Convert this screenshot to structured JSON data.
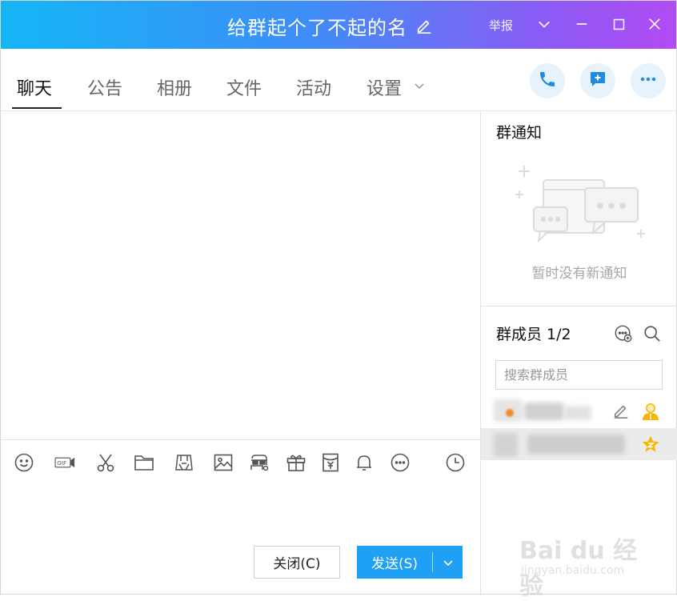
{
  "window": {
    "title": "给群起个了不起的名",
    "report_label": "举报"
  },
  "tabs": [
    {
      "label": "聊天",
      "active": true
    },
    {
      "label": "公告",
      "active": false
    },
    {
      "label": "相册",
      "active": false
    },
    {
      "label": "文件",
      "active": false
    },
    {
      "label": "活动",
      "active": false
    },
    {
      "label": "设置",
      "active": false
    }
  ],
  "header_actions": [
    "phone-icon",
    "add-message-icon",
    "more-icon"
  ],
  "toolbar_icons": [
    "emoji-icon",
    "gif-icon",
    "scissors-icon",
    "folder-icon",
    "screen-record-icon",
    "image-icon",
    "mask-icon",
    "gift-icon",
    "red-packet-icon",
    "bell-icon",
    "more-circle-icon",
    "history-clock-icon"
  ],
  "buttons": {
    "close_label": "关闭(C)",
    "send_label": "发送(S)"
  },
  "right_panel": {
    "notice_title": "群通知",
    "notice_empty": "暂时没有新通知",
    "members_title": "群成员 1/2",
    "member_search_placeholder": "搜索群成员"
  },
  "watermark": {
    "logo": "Bai du 经验",
    "url": "jingyan.baidu.com"
  },
  "colors": {
    "title_gradient_start": "#14b6f7",
    "title_gradient_end": "#b24bf3",
    "accent": "#1ea0f5",
    "round_button_bg": "#e6f3fc",
    "owner_star": "#f5b800"
  }
}
